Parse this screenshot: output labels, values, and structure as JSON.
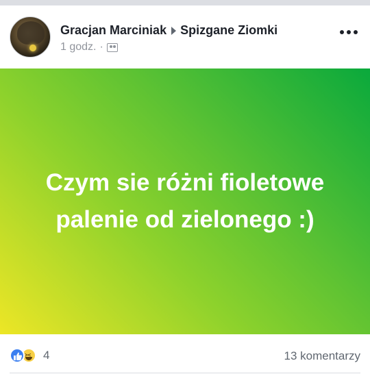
{
  "post": {
    "author": "Gracjan Marciniak",
    "group": "Spizgane Ziomki",
    "time": "1 godz.",
    "separator": "·",
    "privacy_icon": "group-icon",
    "more_icon": "more-dots-icon",
    "text": "Czym sie różni fioletowe palenie od zielonego :)",
    "background_colors": [
      "#0aa93c",
      "#8ed22c",
      "#ede626"
    ]
  },
  "footer": {
    "reaction_icons": [
      "like-icon",
      "haha-icon"
    ],
    "reaction_count": "4",
    "comments": "13 komentarzy"
  }
}
